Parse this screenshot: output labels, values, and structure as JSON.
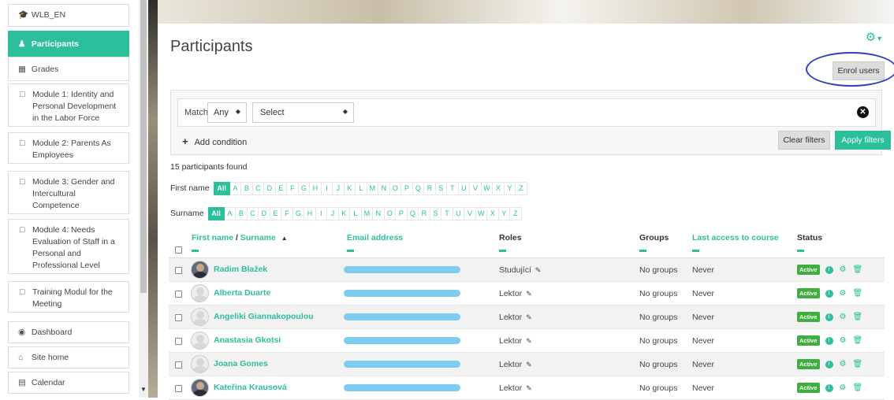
{
  "sidebar": {
    "course": {
      "label": "WLB_EN",
      "icon": "graduation-cap-icon"
    },
    "participants": {
      "label": "Participants",
      "icon": "users-icon"
    },
    "grades": {
      "label": "Grades",
      "icon": "table-icon"
    },
    "module1": {
      "label": "Module 1: Identity and Personal Development in the Labor Force",
      "icon": "folder-icon"
    },
    "module2": {
      "label": "Module 2: Parents As Employees",
      "icon": "folder-icon"
    },
    "module3": {
      "label": "Module 3: Gender and Intercultural Competence",
      "icon": "folder-icon"
    },
    "module4": {
      "label": "Module 4: Needs Evaluation of Staff in a Personal and Professional Level",
      "icon": "folder-icon"
    },
    "training": {
      "label": "Training Modul for the Meeting",
      "icon": "folder-icon"
    },
    "dashboard": {
      "label": "Dashboard",
      "icon": "dashboard-icon"
    },
    "site_home": {
      "label": "Site home",
      "icon": "home-icon"
    },
    "calendar": {
      "label": "Calendar",
      "icon": "calendar-icon"
    }
  },
  "page": {
    "title": "Participants",
    "enrol_label": "Enrol users",
    "accent": "#2bbf9c"
  },
  "filters": {
    "match_label": "Match",
    "match_value": "Any",
    "select_value": "Select",
    "add_condition": "Add condition",
    "clear": "Clear filters",
    "apply": "Apply filters"
  },
  "found_text": "15 participants found",
  "initials": {
    "first_label": "First name",
    "surname_label": "Surname",
    "all": "All",
    "letters": [
      "A",
      "B",
      "C",
      "D",
      "E",
      "F",
      "G",
      "H",
      "I",
      "J",
      "K",
      "L",
      "M",
      "N",
      "O",
      "P",
      "Q",
      "R",
      "S",
      "T",
      "U",
      "V",
      "W",
      "X",
      "Y",
      "Z"
    ]
  },
  "table": {
    "headers": {
      "first_name": "First name",
      "separator": " / ",
      "surname": "Surname",
      "sort_arrow": "▲",
      "email": "Email address",
      "roles": "Roles",
      "groups": "Groups",
      "last_access": "Last access to course",
      "status": "Status"
    },
    "rows": [
      {
        "name": "Radim Blažek",
        "role": "Studující",
        "groups": "No groups",
        "access": "Never",
        "status": "Active",
        "photo": true
      },
      {
        "name": "Alberta Duarte",
        "role": "Lektor",
        "groups": "No groups",
        "access": "Never",
        "status": "Active",
        "photo": false
      },
      {
        "name": "Angeliki Giannakopoulou",
        "role": "Lektor",
        "groups": "No groups",
        "access": "Never",
        "status": "Active",
        "photo": false
      },
      {
        "name": "Anastasia Gkotsi",
        "role": "Lektor",
        "groups": "No groups",
        "access": "Never",
        "status": "Active",
        "photo": false
      },
      {
        "name": "Joana Gomes",
        "role": "Lektor",
        "groups": "No groups",
        "access": "Never",
        "status": "Active",
        "photo": false
      },
      {
        "name": "Kateřina Krausová",
        "role": "Lektor",
        "groups": "No groups",
        "access": "Never",
        "status": "Active",
        "photo": true
      }
    ]
  }
}
